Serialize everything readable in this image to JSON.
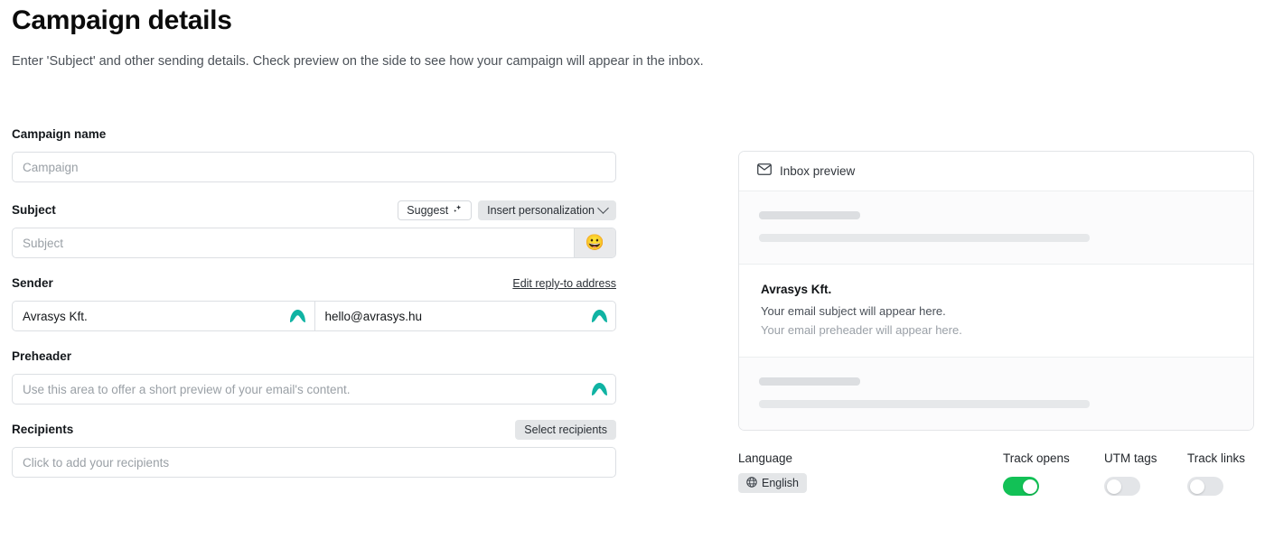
{
  "header": {
    "title": "Campaign details",
    "subtitle": "Enter 'Subject' and other sending details. Check preview on the side to see how your campaign will appear in the inbox."
  },
  "form": {
    "campaign_name": {
      "label": "Campaign name",
      "value": "",
      "placeholder": "Campaign"
    },
    "subject": {
      "label": "Subject",
      "value": "",
      "placeholder": "Subject",
      "suggest_button": "Suggest",
      "personalization_button": "Insert personalization",
      "emoji_button": "😀"
    },
    "sender": {
      "label": "Sender",
      "edit_reply_to_link": "Edit reply-to address",
      "name_value": "Avrasys Kft.",
      "email_value": "hello@avrasys.hu"
    },
    "preheader": {
      "label": "Preheader",
      "value": "",
      "placeholder": "Use this area to offer a short preview of your email's content."
    },
    "recipients": {
      "label": "Recipients",
      "select_button": "Select recipients",
      "value": "",
      "placeholder": "Click to add your recipients"
    }
  },
  "preview": {
    "header_label": "Inbox preview",
    "email": {
      "sender": "Avrasys Kft.",
      "subject": "Your email subject will appear here.",
      "preheader": "Your email preheader will appear here."
    }
  },
  "options": {
    "language_label": "Language",
    "language_value": "English",
    "toggles": [
      {
        "label": "Track opens",
        "state": "on"
      },
      {
        "label": "UTM tags",
        "state": "off"
      },
      {
        "label": "Track links",
        "state": "off"
      }
    ]
  },
  "colors": {
    "accent_green": "#12c156",
    "preview_accent": "#2cc362",
    "verified_teal": "#10b3a3"
  }
}
